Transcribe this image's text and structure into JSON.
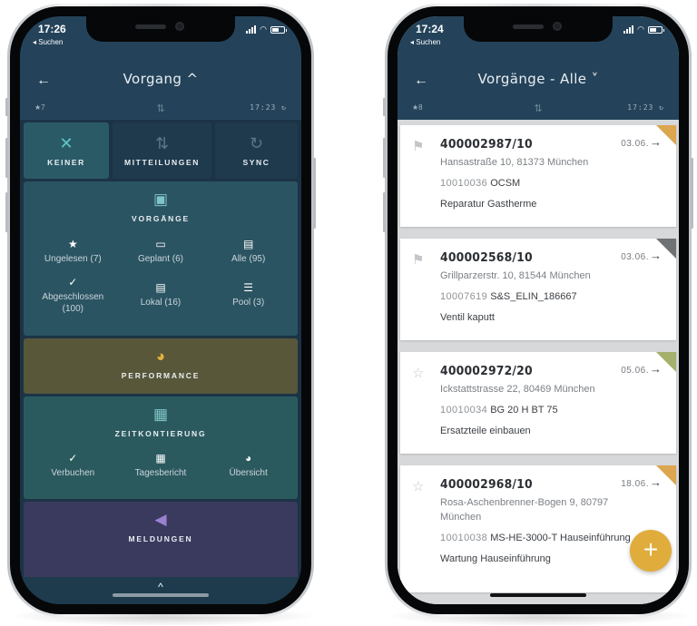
{
  "left_phone": {
    "status": {
      "time": "17:26",
      "back_app": "◂ Suchen"
    },
    "header": {
      "back_icon": "←",
      "title": "Vorgang ^",
      "unread_count": "★7",
      "transfer_icon": "⇅",
      "sync_time": "17:23 ↻"
    },
    "top_tiles": [
      {
        "icon": "✕",
        "label": "KEINER"
      },
      {
        "icon": "⇅",
        "label": "MITTEILUNGEN"
      },
      {
        "icon": "↻",
        "label": "SYNC"
      }
    ],
    "sections": {
      "vorgaenge": {
        "icon": "📋",
        "label": "VORGÄNGE",
        "items": [
          {
            "icon": "★",
            "label": "Ungelesen (7)"
          },
          {
            "icon": "💼",
            "label": "Geplant (6)"
          },
          {
            "icon": "📋",
            "label": "Alle (95)"
          },
          {
            "icon": "✓",
            "label": "Abgeschlossen (100)"
          },
          {
            "icon": "📋",
            "label": "Lokal (16)"
          },
          {
            "icon": "☰",
            "label": "Pool (3)"
          }
        ]
      },
      "performance": {
        "icon": "◕",
        "label": "PERFORMANCE"
      },
      "zeitkontierung": {
        "icon": "📅",
        "label": "ZEITKONTIERUNG",
        "items": [
          {
            "icon": "✓",
            "label": "Verbuchen"
          },
          {
            "icon": "📅",
            "label": "Tagesbericht"
          },
          {
            "icon": "◕",
            "label": "Übersicht"
          }
        ]
      },
      "meldungen": {
        "icon": "📢",
        "label": "MELDUNGEN"
      }
    },
    "bottom": {
      "collapse_icon": "^"
    },
    "colors": {
      "header": "#24435a",
      "keiner": "#2b5a67",
      "vorgaenge": "#2b5462",
      "performance": "#58573a",
      "zeitkontierung": "#2b5a5e",
      "meldungen": "#393a5e"
    }
  },
  "right_phone": {
    "status": {
      "time": "17:24",
      "back_app": "◂ Suchen"
    },
    "header": {
      "back_icon": "←",
      "title": "Vorgänge - Alle ˅",
      "unread_count": "★8",
      "transfer_icon": "⇅",
      "sync_time": "17:23 ↻"
    },
    "orders": [
      {
        "icon": "flag",
        "number": "400002987/10",
        "date": "03.06.",
        "address": "Hansastraße 10, 81373 München",
        "equipment_no": "10010036",
        "equipment_desc": "OCSM",
        "description": "Reparatur Gastherme",
        "priority_color": "#dca64f"
      },
      {
        "icon": "flag",
        "number": "400002568/10",
        "date": "03.06.",
        "address": "Grillparzerstr. 10, 81544 München",
        "equipment_no": "10007619",
        "equipment_desc": "S&S_ELIN_186667",
        "description": "Ventil kaputt",
        "priority_color": "#6f7275"
      },
      {
        "icon": "star",
        "number": "400002972/20",
        "date": "05.06.",
        "address": "Ickstattstrasse 22, 80469 München",
        "equipment_no": "10010034",
        "equipment_desc": "BG 20 H BT 75",
        "description": "Ersatzteile einbauen",
        "priority_color": "#a4b06c"
      },
      {
        "icon": "star",
        "number": "400002968/10",
        "date": "18.06.",
        "address": "Rosa-Aschenbrenner-Bogen 9, 80797 München",
        "equipment_no": "10010038",
        "equipment_desc": "MS-HE-3000-T Hauseinführung",
        "description": "Wartung Hauseinführung",
        "priority_color": "#dca64f"
      }
    ],
    "fab": {
      "icon": "+",
      "color": "#e0ac3c"
    }
  }
}
